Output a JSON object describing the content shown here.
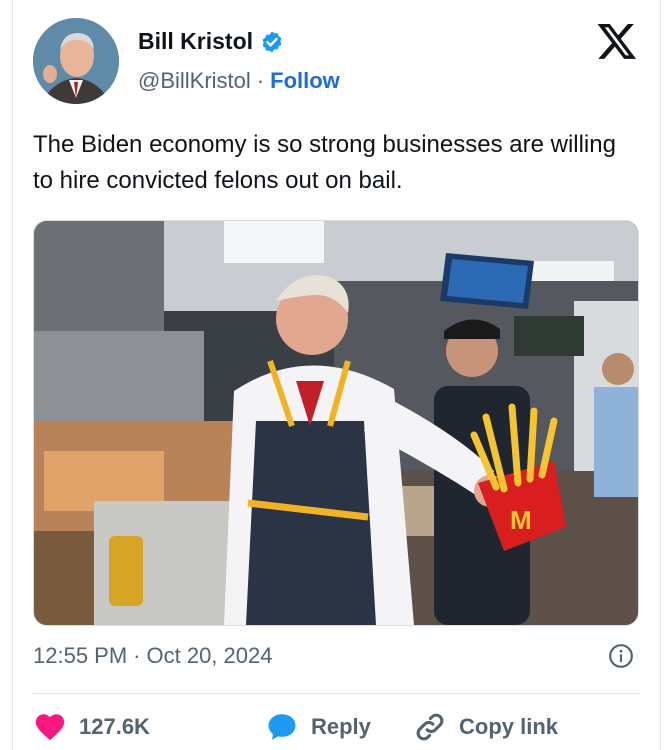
{
  "author": {
    "name": "Bill Kristol",
    "handle": "@BillKristol",
    "follow_label": "Follow",
    "separator": "·"
  },
  "tweet": {
    "text": "The Biden economy is so strong businesses are willing to hire convicted felons out on bail.",
    "time": "12:55 PM",
    "date": "Oct 20, 2024",
    "separator": "·"
  },
  "actions": {
    "like_count": "127.6K",
    "reply_label": "Reply",
    "copy_label": "Copy link"
  },
  "colors": {
    "accent": "#1d9bf0",
    "like": "#f91880",
    "text": "#0f1419",
    "muted": "#536471"
  },
  "icons": [
    "verified-badge-icon",
    "x-logo-icon",
    "info-icon",
    "heart-icon",
    "reply-bubble-icon",
    "link-icon"
  ]
}
